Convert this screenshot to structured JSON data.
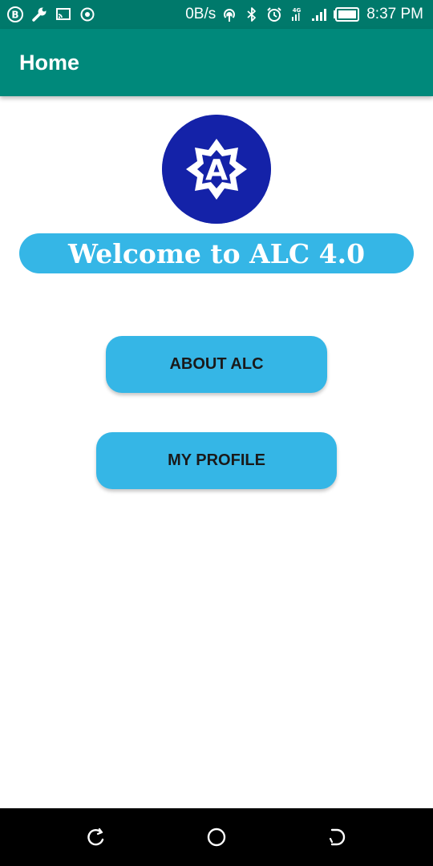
{
  "status_bar": {
    "icons_left": [
      "b-badge-icon",
      "wrench-icon",
      "cast-icon",
      "record-icon"
    ],
    "network_speed": "0B/s",
    "network_type": "4G",
    "time": "8:37 PM",
    "icons_right": [
      "hotspot-icon",
      "bluetooth-icon",
      "alarm-icon",
      "signal-4g-icon",
      "signal-icon",
      "battery-icon"
    ]
  },
  "app_bar": {
    "title": "Home",
    "color": "#00897b"
  },
  "logo": {
    "letter": "A",
    "background": "#1422a8"
  },
  "welcome": {
    "text": "Welcome to ALC 4.0",
    "color": "#35b6e6"
  },
  "buttons": {
    "about_label": "ABOUT ALC",
    "profile_label": "MY PROFILE",
    "color": "#35b6e6"
  },
  "nav_bar": {
    "icons": [
      "recent-apps-icon",
      "home-icon",
      "back-icon"
    ]
  }
}
